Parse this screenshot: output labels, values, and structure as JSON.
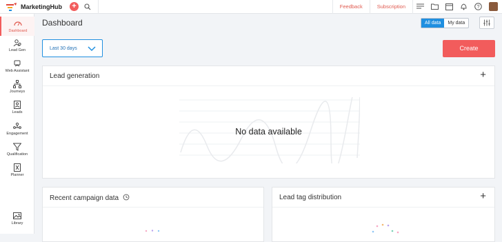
{
  "app": {
    "name": "MarketingHub"
  },
  "topbar": {
    "feedback": "Feedback",
    "subscription": "Subscription",
    "icons": [
      "list-icon",
      "folder-icon",
      "calendar-icon",
      "bell-icon",
      "help-icon"
    ]
  },
  "sidebar": {
    "items": [
      {
        "label": "Dashboard",
        "icon": "dashboard-icon",
        "active": true
      },
      {
        "label": "Lead Gen",
        "icon": "lead-gen-icon"
      },
      {
        "label": "Web Assistant",
        "icon": "web-assistant-icon"
      },
      {
        "label": "Journeys",
        "icon": "journeys-icon"
      },
      {
        "label": "Leads",
        "icon": "leads-icon"
      },
      {
        "label": "Engagement",
        "icon": "engagement-icon"
      },
      {
        "label": "Qualification",
        "icon": "qualification-icon"
      },
      {
        "label": "Planner",
        "icon": "planner-icon"
      },
      {
        "label": "Library",
        "icon": "library-icon"
      }
    ]
  },
  "main": {
    "title": "Dashboard",
    "toggle": {
      "all": "All data",
      "mine": "My data",
      "selected": "All data"
    },
    "date_filter": "Last 30 days",
    "create_label": "Create"
  },
  "cards": {
    "lead_generation": {
      "title": "Lead generation",
      "empty_text": "No data available"
    },
    "recent_campaign": {
      "title": "Recent campaign data"
    },
    "lead_tag": {
      "title": "Lead tag distribution"
    }
  },
  "colors": {
    "accent": "#f25c5c",
    "primary": "#1f8fe0"
  }
}
